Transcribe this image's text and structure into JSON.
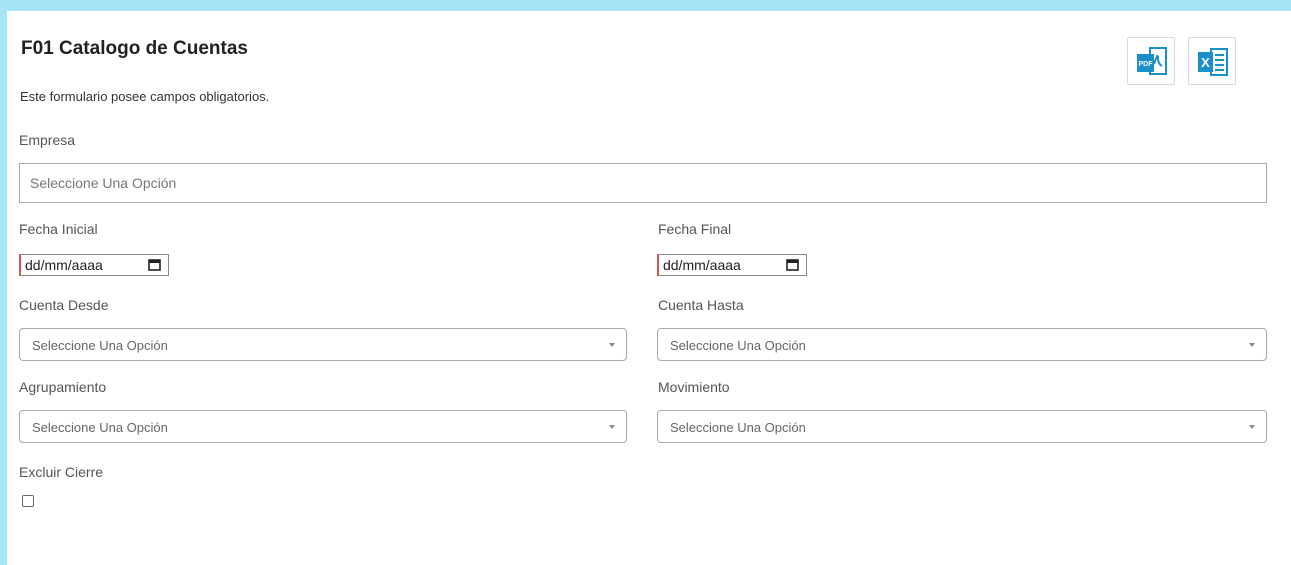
{
  "header": {
    "title": "F01 Catalogo de Cuentas",
    "subtitle": "Este formulario posee campos obligatorios."
  },
  "export": {
    "pdf_icon": "pdf-file-icon",
    "pdf_text": "PDF",
    "excel_icon": "excel-file-icon",
    "excel_text": "X",
    "icon_color": "#1a8fc9"
  },
  "form": {
    "empresa": {
      "label": "Empresa",
      "placeholder": "Seleccione Una Opción"
    },
    "fecha_inicial": {
      "label": "Fecha Inicial",
      "value": "dd/mm/aaaa"
    },
    "fecha_final": {
      "label": "Fecha Final",
      "value": "dd/mm/aaaa"
    },
    "cuenta_desde": {
      "label": "Cuenta Desde",
      "selected": "Seleccione Una Opción"
    },
    "cuenta_hasta": {
      "label": "Cuenta Hasta",
      "selected": "Seleccione Una Opción"
    },
    "agrupamiento": {
      "label": "Agrupamiento",
      "selected": "Seleccione Una Opción"
    },
    "movimiento": {
      "label": "Movimiento",
      "selected": "Seleccione Una Opción"
    },
    "excluir_cierre": {
      "label": "Excluir Cierre",
      "checked": false
    }
  },
  "colors": {
    "page_background": "#a6e4f6",
    "required_marker": "#d9534f"
  }
}
